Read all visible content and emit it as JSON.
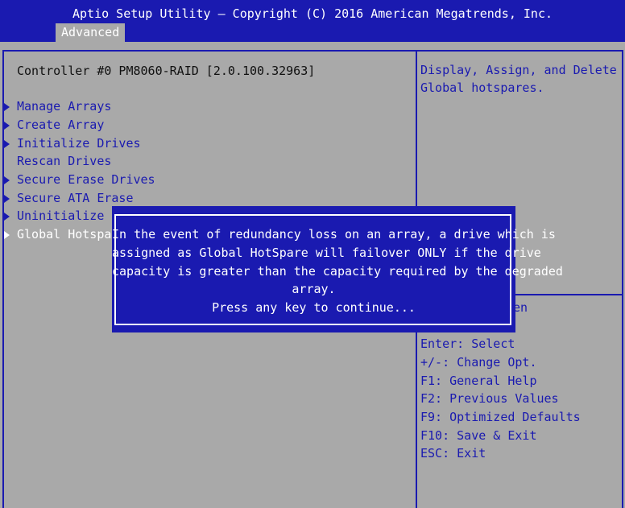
{
  "header": {
    "title": "Aptio Setup Utility – Copyright (C) 2016 American Megatrends, Inc.",
    "tab": "Advanced"
  },
  "main": {
    "controller": "Controller #0 PM8060-RAID [2.0.100.32963]",
    "menu": [
      {
        "label": "Manage Arrays",
        "arrow": true
      },
      {
        "label": "Create Array",
        "arrow": true
      },
      {
        "label": "Initialize Drives",
        "arrow": true
      },
      {
        "label": "Rescan Drives",
        "arrow": false
      },
      {
        "label": "Secure Erase Drives",
        "arrow": true
      },
      {
        "label": "Secure ATA Erase",
        "arrow": true
      },
      {
        "label": "Uninitialize Dr",
        "arrow": true
      },
      {
        "label": "Global Hotspare",
        "arrow": true
      }
    ]
  },
  "help": {
    "description_line1": "Display, Assign, and Delete",
    "description_line2": "Global hotspares.",
    "partial": "en",
    "keys": [
      "Enter: Select",
      "+/-: Change Opt.",
      "F1: General Help",
      "F2: Previous Values",
      "F9: Optimized Defaults",
      "F10: Save & Exit",
      "ESC: Exit"
    ]
  },
  "dialog": {
    "lines": [
      "In the event of redundancy loss on an array, a drive which is",
      "assigned as Global HotSpare will failover ONLY if the drive",
      "capacity is greater than the capacity required by the degraded",
      "array.",
      "Press any key to continue..."
    ]
  },
  "colors": {
    "bios_blue": "#1a1ab0",
    "bios_gray": "#a9a9a9",
    "white": "#ffffff"
  }
}
